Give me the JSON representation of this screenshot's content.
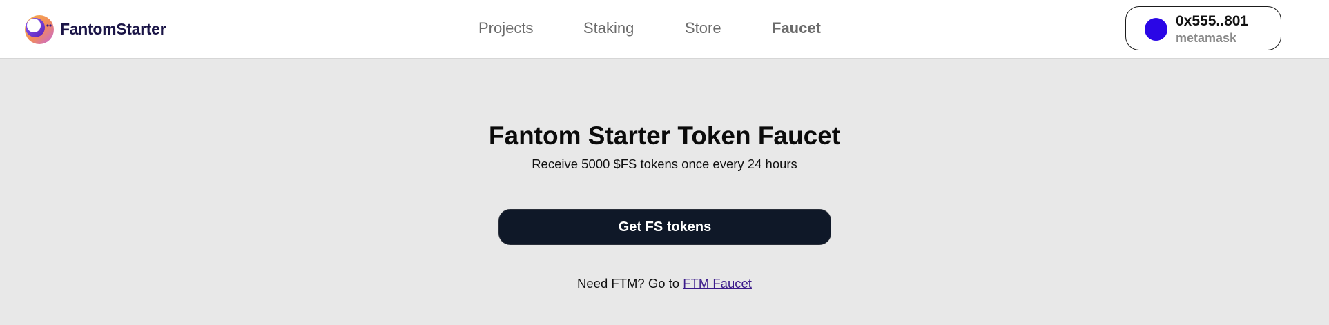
{
  "header": {
    "brand": {
      "name": "FantomStarter",
      "logo_icon": "fantomstarter-logo-icon"
    },
    "nav": [
      {
        "label": "Projects",
        "active": false
      },
      {
        "label": "Staking",
        "active": false
      },
      {
        "label": "Store",
        "active": false
      },
      {
        "label": "Faucet",
        "active": true
      }
    ],
    "wallet": {
      "address": "0x555..801",
      "provider": "metamask",
      "avatar_color": "#2a06e6"
    }
  },
  "main": {
    "title": "Fantom Starter Token Faucet",
    "subtitle": "Receive 5000 $FS tokens once every 24 hours",
    "cta_label": "Get FS tokens",
    "footnote": {
      "prefix": "Need FTM? Go to ",
      "link_label": "FTM Faucet"
    }
  },
  "colors": {
    "background": "#e8e8e8",
    "header_bg": "#ffffff",
    "button_bg": "#0f1828",
    "link": "#3b1a8a",
    "nav_text": "#6b6b6b"
  }
}
